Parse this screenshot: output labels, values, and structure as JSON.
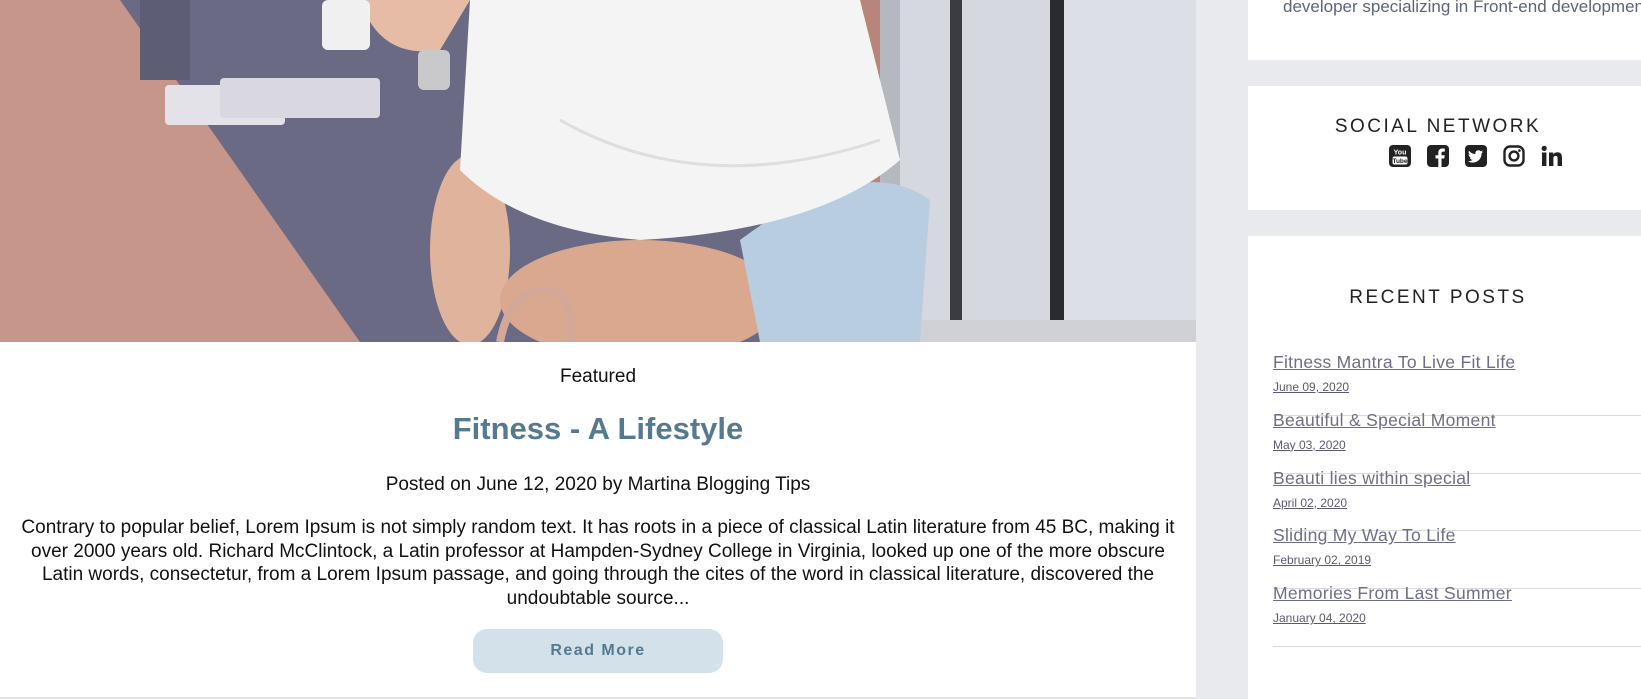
{
  "post": {
    "image_alt": "Woman in white off-shoulder top sitting by a window",
    "category": "Featured",
    "title": "Fitness - A Lifestyle",
    "meta": "Posted on June 12, 2020 by Martina Blogging Tips",
    "excerpt": "Contrary to popular belief, Lorem Ipsum is not simply random text. It has roots in a piece of classical Latin literature from 45 BC, making it over 2000 years old. Richard McClintock, a Latin professor at Hampden-Sydney College in Virginia, looked up one of the more obscure Latin words, consectetur, from a Lorem Ipsum passage, and going through the cites of the word in classical literature, discovered the undoubtable source...",
    "read_more_label": "Read More"
  },
  "sidebar": {
    "about": {
      "text": "developer specializing in Front-end development"
    },
    "social": {
      "heading": "SOCIAL NETWORK",
      "icons": [
        "youtube-icon",
        "facebook-icon",
        "twitter-icon",
        "instagram-icon",
        "linkedin-icon"
      ]
    },
    "recent_posts": {
      "heading": "RECENT POSTS",
      "items": [
        {
          "title": "Fitness Mantra To Live Fit Life",
          "date": "June 09, 2020"
        },
        {
          "title": "Beautiful & Special Moment",
          "date": "May 03, 2020"
        },
        {
          "title": "Beauti lies within special",
          "date": "April 02, 2020"
        },
        {
          "title": "Sliding My Way To Life",
          "date": "February 02, 2019"
        },
        {
          "title": "Memories From Last Summer",
          "date": "January 04, 2020"
        }
      ]
    }
  },
  "colors": {
    "accent": "#557a90",
    "button_bg": "#d2e1ea",
    "page_bg": "#e9eaee",
    "link": "#6e6e86"
  }
}
